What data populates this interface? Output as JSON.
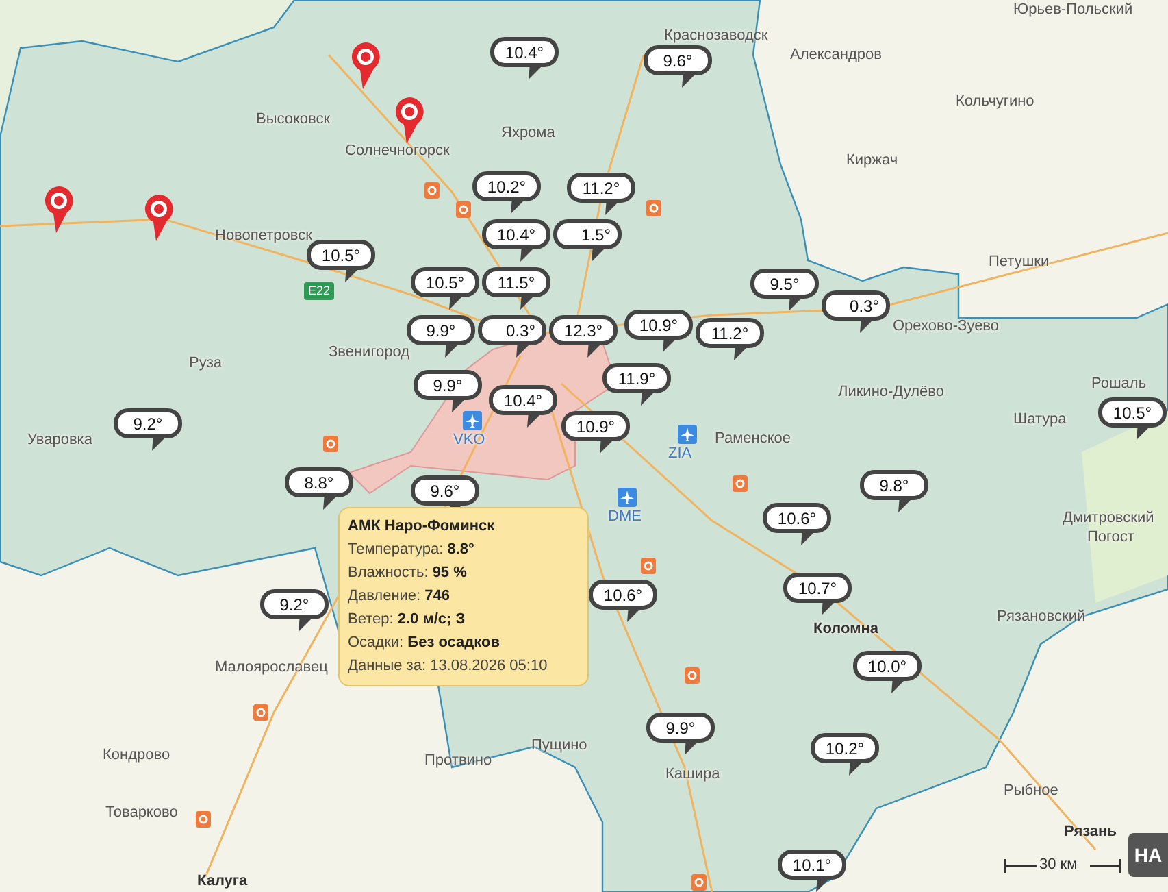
{
  "markers": [
    {
      "label": "10.4°"
    },
    {
      "label": "9.6°"
    },
    {
      "label": "10.2°"
    },
    {
      "label": "11.2°"
    },
    {
      "label": "10.5°"
    },
    {
      "label": "10.4°"
    },
    {
      "label": "10.5°"
    },
    {
      "label": "1.5°"
    },
    {
      "label": "11.5°"
    },
    {
      "label": "9.9°"
    },
    {
      "label": "0.3°"
    },
    {
      "label": "12.3°"
    },
    {
      "label": "10.9°"
    },
    {
      "label": "11.2°"
    },
    {
      "label": "9.5°"
    },
    {
      "label": "0.3°"
    },
    {
      "label": "11.9°"
    },
    {
      "label": "9.9°"
    },
    {
      "label": "10.4°"
    },
    {
      "label": "10.9°"
    },
    {
      "label": "9.2°"
    },
    {
      "label": "10.5°"
    },
    {
      "label": "8.8°"
    },
    {
      "label": "9.6°"
    },
    {
      "label": "9.8°"
    },
    {
      "label": "10.6°"
    },
    {
      "label": "10.6°"
    },
    {
      "label": "10.7°"
    },
    {
      "label": "9.2°"
    },
    {
      "label": "10.0°"
    },
    {
      "label": "9.9°"
    },
    {
      "label": "10.2°"
    },
    {
      "label": "10.1°"
    }
  ],
  "places": [
    {
      "name": "Юрьев-Польский",
      "major": false
    },
    {
      "name": "Краснозаводск",
      "major": false
    },
    {
      "name": "Александров",
      "major": false
    },
    {
      "name": "Высоковск",
      "major": false
    },
    {
      "name": "Яхрома",
      "major": false
    },
    {
      "name": "Кольчугино",
      "major": false
    },
    {
      "name": "Солнечногорск",
      "major": false
    },
    {
      "name": "Киржач",
      "major": false
    },
    {
      "name": "Новопетровск",
      "major": false
    },
    {
      "name": "Петушки",
      "major": false
    },
    {
      "name": "Орехово-Зуево",
      "major": false
    },
    {
      "name": "Звенигород",
      "major": false
    },
    {
      "name": "Руза",
      "major": false
    },
    {
      "name": "Ликино-Дулёво",
      "major": false
    },
    {
      "name": "Рошаль",
      "major": false
    },
    {
      "name": "Шатура",
      "major": false
    },
    {
      "name": "Уваровка",
      "major": false
    },
    {
      "name": "Раменское",
      "major": false
    },
    {
      "name": "Дмитровский",
      "major": false
    },
    {
      "name": "Погост",
      "major": false
    },
    {
      "name": "Рязановский",
      "major": false
    },
    {
      "name": "Коломна",
      "major": true
    },
    {
      "name": "Малоярославец",
      "major": false
    },
    {
      "name": "Пущино",
      "major": false
    },
    {
      "name": "Кондрово",
      "major": false
    },
    {
      "name": "Протвино",
      "major": false
    },
    {
      "name": "Кашира",
      "major": false
    },
    {
      "name": "Рыбное",
      "major": false
    },
    {
      "name": "Товарково",
      "major": false
    },
    {
      "name": "Рязань",
      "major": true
    },
    {
      "name": "Калуга",
      "major": true
    }
  ],
  "airports": [
    {
      "code": "VKO"
    },
    {
      "code": "ZIA"
    },
    {
      "code": "DME"
    }
  ],
  "road_badge": "E22",
  "tooltip": {
    "title": "АМК Наро-Фоминск",
    "rows": [
      {
        "label": "Температура:",
        "value": "8.8°"
      },
      {
        "label": "Влажность:",
        "value": "95 %"
      },
      {
        "label": "Давление:",
        "value": "746"
      },
      {
        "label": "Ветер:",
        "value": "2.0 м/с; З"
      },
      {
        "label": "Осадки:",
        "value": "Без осадков"
      }
    ],
    "footer": "Данные за: 13.08.2026 05:10"
  },
  "scale": "30 км",
  "corner_button": "НА"
}
